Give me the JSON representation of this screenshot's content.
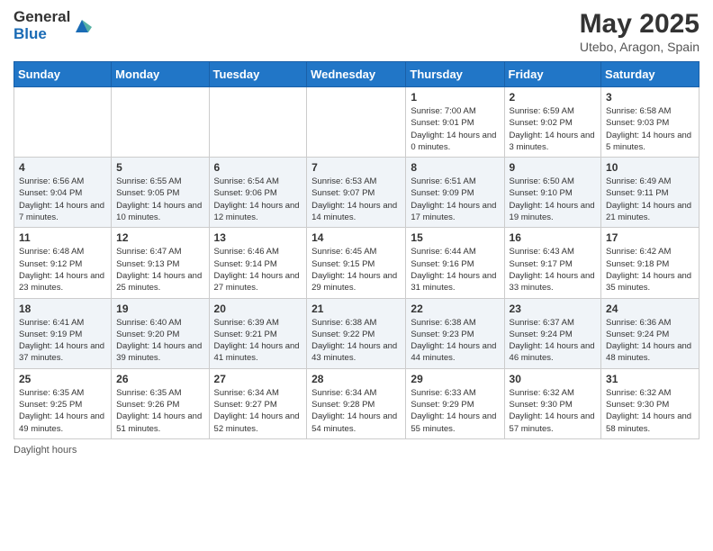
{
  "logo": {
    "general": "General",
    "blue": "Blue"
  },
  "title": "May 2025",
  "subtitle": "Utebo, Aragon, Spain",
  "days_of_week": [
    "Sunday",
    "Monday",
    "Tuesday",
    "Wednesday",
    "Thursday",
    "Friday",
    "Saturday"
  ],
  "footer": "Daylight hours",
  "weeks": [
    [
      {
        "day": "",
        "sunrise": "",
        "sunset": "",
        "daylight": ""
      },
      {
        "day": "",
        "sunrise": "",
        "sunset": "",
        "daylight": ""
      },
      {
        "day": "",
        "sunrise": "",
        "sunset": "",
        "daylight": ""
      },
      {
        "day": "",
        "sunrise": "",
        "sunset": "",
        "daylight": ""
      },
      {
        "day": "1",
        "sunrise": "Sunrise: 7:00 AM",
        "sunset": "Sunset: 9:01 PM",
        "daylight": "Daylight: 14 hours and 0 minutes."
      },
      {
        "day": "2",
        "sunrise": "Sunrise: 6:59 AM",
        "sunset": "Sunset: 9:02 PM",
        "daylight": "Daylight: 14 hours and 3 minutes."
      },
      {
        "day": "3",
        "sunrise": "Sunrise: 6:58 AM",
        "sunset": "Sunset: 9:03 PM",
        "daylight": "Daylight: 14 hours and 5 minutes."
      }
    ],
    [
      {
        "day": "4",
        "sunrise": "Sunrise: 6:56 AM",
        "sunset": "Sunset: 9:04 PM",
        "daylight": "Daylight: 14 hours and 7 minutes."
      },
      {
        "day": "5",
        "sunrise": "Sunrise: 6:55 AM",
        "sunset": "Sunset: 9:05 PM",
        "daylight": "Daylight: 14 hours and 10 minutes."
      },
      {
        "day": "6",
        "sunrise": "Sunrise: 6:54 AM",
        "sunset": "Sunset: 9:06 PM",
        "daylight": "Daylight: 14 hours and 12 minutes."
      },
      {
        "day": "7",
        "sunrise": "Sunrise: 6:53 AM",
        "sunset": "Sunset: 9:07 PM",
        "daylight": "Daylight: 14 hours and 14 minutes."
      },
      {
        "day": "8",
        "sunrise": "Sunrise: 6:51 AM",
        "sunset": "Sunset: 9:09 PM",
        "daylight": "Daylight: 14 hours and 17 minutes."
      },
      {
        "day": "9",
        "sunrise": "Sunrise: 6:50 AM",
        "sunset": "Sunset: 9:10 PM",
        "daylight": "Daylight: 14 hours and 19 minutes."
      },
      {
        "day": "10",
        "sunrise": "Sunrise: 6:49 AM",
        "sunset": "Sunset: 9:11 PM",
        "daylight": "Daylight: 14 hours and 21 minutes."
      }
    ],
    [
      {
        "day": "11",
        "sunrise": "Sunrise: 6:48 AM",
        "sunset": "Sunset: 9:12 PM",
        "daylight": "Daylight: 14 hours and 23 minutes."
      },
      {
        "day": "12",
        "sunrise": "Sunrise: 6:47 AM",
        "sunset": "Sunset: 9:13 PM",
        "daylight": "Daylight: 14 hours and 25 minutes."
      },
      {
        "day": "13",
        "sunrise": "Sunrise: 6:46 AM",
        "sunset": "Sunset: 9:14 PM",
        "daylight": "Daylight: 14 hours and 27 minutes."
      },
      {
        "day": "14",
        "sunrise": "Sunrise: 6:45 AM",
        "sunset": "Sunset: 9:15 PM",
        "daylight": "Daylight: 14 hours and 29 minutes."
      },
      {
        "day": "15",
        "sunrise": "Sunrise: 6:44 AM",
        "sunset": "Sunset: 9:16 PM",
        "daylight": "Daylight: 14 hours and 31 minutes."
      },
      {
        "day": "16",
        "sunrise": "Sunrise: 6:43 AM",
        "sunset": "Sunset: 9:17 PM",
        "daylight": "Daylight: 14 hours and 33 minutes."
      },
      {
        "day": "17",
        "sunrise": "Sunrise: 6:42 AM",
        "sunset": "Sunset: 9:18 PM",
        "daylight": "Daylight: 14 hours and 35 minutes."
      }
    ],
    [
      {
        "day": "18",
        "sunrise": "Sunrise: 6:41 AM",
        "sunset": "Sunset: 9:19 PM",
        "daylight": "Daylight: 14 hours and 37 minutes."
      },
      {
        "day": "19",
        "sunrise": "Sunrise: 6:40 AM",
        "sunset": "Sunset: 9:20 PM",
        "daylight": "Daylight: 14 hours and 39 minutes."
      },
      {
        "day": "20",
        "sunrise": "Sunrise: 6:39 AM",
        "sunset": "Sunset: 9:21 PM",
        "daylight": "Daylight: 14 hours and 41 minutes."
      },
      {
        "day": "21",
        "sunrise": "Sunrise: 6:38 AM",
        "sunset": "Sunset: 9:22 PM",
        "daylight": "Daylight: 14 hours and 43 minutes."
      },
      {
        "day": "22",
        "sunrise": "Sunrise: 6:38 AM",
        "sunset": "Sunset: 9:23 PM",
        "daylight": "Daylight: 14 hours and 44 minutes."
      },
      {
        "day": "23",
        "sunrise": "Sunrise: 6:37 AM",
        "sunset": "Sunset: 9:24 PM",
        "daylight": "Daylight: 14 hours and 46 minutes."
      },
      {
        "day": "24",
        "sunrise": "Sunrise: 6:36 AM",
        "sunset": "Sunset: 9:24 PM",
        "daylight": "Daylight: 14 hours and 48 minutes."
      }
    ],
    [
      {
        "day": "25",
        "sunrise": "Sunrise: 6:35 AM",
        "sunset": "Sunset: 9:25 PM",
        "daylight": "Daylight: 14 hours and 49 minutes."
      },
      {
        "day": "26",
        "sunrise": "Sunrise: 6:35 AM",
        "sunset": "Sunset: 9:26 PM",
        "daylight": "Daylight: 14 hours and 51 minutes."
      },
      {
        "day": "27",
        "sunrise": "Sunrise: 6:34 AM",
        "sunset": "Sunset: 9:27 PM",
        "daylight": "Daylight: 14 hours and 52 minutes."
      },
      {
        "day": "28",
        "sunrise": "Sunrise: 6:34 AM",
        "sunset": "Sunset: 9:28 PM",
        "daylight": "Daylight: 14 hours and 54 minutes."
      },
      {
        "day": "29",
        "sunrise": "Sunrise: 6:33 AM",
        "sunset": "Sunset: 9:29 PM",
        "daylight": "Daylight: 14 hours and 55 minutes."
      },
      {
        "day": "30",
        "sunrise": "Sunrise: 6:32 AM",
        "sunset": "Sunset: 9:30 PM",
        "daylight": "Daylight: 14 hours and 57 minutes."
      },
      {
        "day": "31",
        "sunrise": "Sunrise: 6:32 AM",
        "sunset": "Sunset: 9:30 PM",
        "daylight": "Daylight: 14 hours and 58 minutes."
      }
    ]
  ]
}
